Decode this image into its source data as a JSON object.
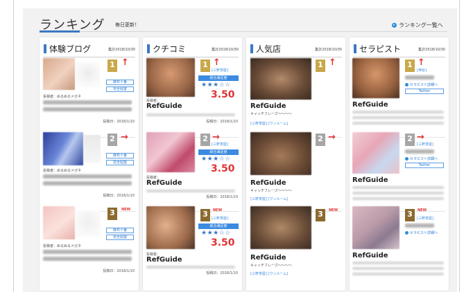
{
  "header": {
    "title": "ランキング",
    "subtitle": "毎日更新！",
    "link_label": "ランキング一覧へ"
  },
  "columns": [
    {
      "title": "体験ブログ",
      "date": "集計2018/10/30",
      "cards": [
        {
          "rank": "1",
          "rank_style": "gold",
          "trend": "↑",
          "tags": [
            "麻布十番",
            "完全個室"
          ],
          "poster_label": "投稿者：ぬるぬるメガネ",
          "post_date": "投稿日：2018/1/10"
        },
        {
          "rank": "2",
          "rank_style": "silver",
          "trend": "→",
          "tags": [
            "麻布十番",
            "完全個室"
          ],
          "poster_label": "投稿者：ぬるぬるメガネ",
          "post_date": "投稿日：2018/1/10"
        },
        {
          "rank": "3",
          "rank_style": "bronze",
          "trend": "NEW",
          "tags": [
            "麻布十番",
            "完全個室"
          ],
          "poster_label": "投稿者：ぬるぬるメガネ",
          "post_date": "投稿日：2018/1/10"
        }
      ]
    },
    {
      "title": "クチコミ",
      "date": "集計2018/10/30",
      "cards": [
        {
          "rank": "1",
          "rank_style": "gold",
          "trend": "↑",
          "area": "[三軒茶屋]",
          "rating_label": "総合満足度",
          "stars": "★★★☆☆",
          "score": "3.50",
          "poster_label": "投稿者：",
          "name": "RefGuide",
          "post_date": "投稿日：2018/1/10"
        },
        {
          "rank": "2",
          "rank_style": "silver",
          "trend": "→",
          "area": "[三軒茶屋]",
          "rating_label": "総合満足度",
          "stars": "★★★☆☆",
          "score": "3.50",
          "poster_label": "投稿者：",
          "name": "RefGuide",
          "post_date": "投稿日：2018/1/10"
        },
        {
          "rank": "3",
          "rank_style": "bronze",
          "trend": "NEW",
          "area": "[三軒茶屋]",
          "rating_label": "総合満足度",
          "stars": "★★★☆☆",
          "score": "3.50",
          "poster_label": "投稿者：",
          "name": "RefGuide",
          "post_date": "投稿日：2018/1/10"
        }
      ]
    },
    {
      "title": "人気店",
      "date": "集計2018/10/30",
      "cards": [
        {
          "rank": "1",
          "rank_style": "gold",
          "trend": "↑",
          "name": "RefGuide",
          "catch": "キャッチフレーズ〜〜〜〜",
          "links": "[三軒茶屋] [ワンルーム]"
        },
        {
          "rank": "2",
          "rank_style": "silver",
          "trend": "→",
          "name": "RefGuide",
          "catch": "キャッチフレーズ〜〜〜〜",
          "links": "[三軒茶屋] [ワンルーム]"
        },
        {
          "rank": "3",
          "rank_style": "bronze",
          "trend": "NEW",
          "name": "RefGuide",
          "catch": "キャッチフレーズ〜〜〜〜",
          "links": "[三軒茶屋] [ワンルーム]"
        }
      ]
    },
    {
      "title": "セラピスト",
      "date": "集計2018/10/30",
      "cards": [
        {
          "rank": "1",
          "rank_style": "gold",
          "trend": "↑",
          "area": "[神谷]",
          "detail_link": "セラピスト詳細へ",
          "twitter": "Twitter",
          "name": "RefGuide"
        },
        {
          "rank": "2",
          "rank_style": "silver",
          "trend": "→",
          "area": "[三軒茶屋]",
          "detail_link": "セラピスト詳細へ",
          "twitter": "Twitter",
          "name": "RefGuide"
        },
        {
          "rank": "3",
          "rank_style": "bronze",
          "trend": "NEW",
          "area": "[三軒茶屋]",
          "detail_link": "セラピスト詳細へ",
          "name": "RefGuide"
        }
      ]
    }
  ],
  "colors": {
    "accent": "#3b78c4",
    "trend_red": "#e03434",
    "gold": "#c9a84a",
    "silver": "#a6a6a6",
    "bronze": "#8c6a2f"
  }
}
